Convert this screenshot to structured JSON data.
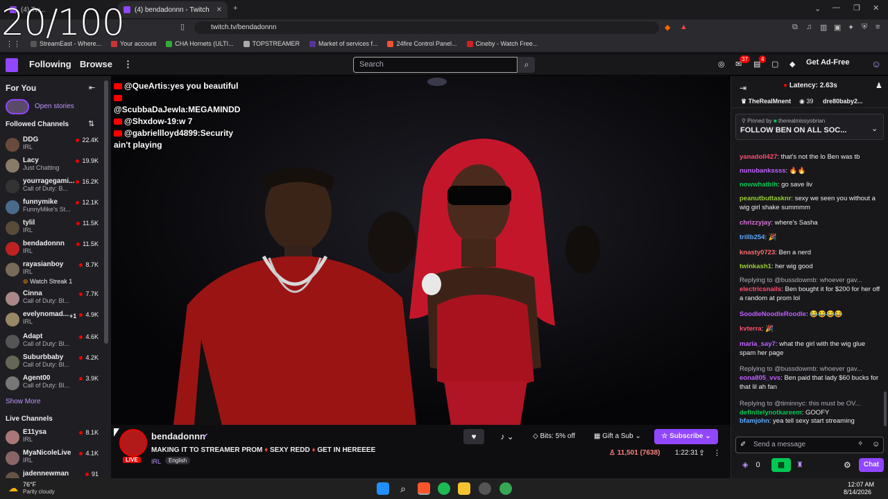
{
  "overlay": {
    "counter": "20/100"
  },
  "browser": {
    "tabs": [
      {
        "label": "(4) Tw..."
      },
      {
        "label": "(4) bendadonnn - Twitch"
      }
    ],
    "url": "twitch.tv/bendadonnn",
    "bookmarks": [
      {
        "label": "StreamEast - Where...",
        "color": "#555"
      },
      {
        "label": "Your account",
        "color": "#c33"
      },
      {
        "label": "CHA Hornets (ULTI...",
        "color": "#3a3"
      },
      {
        "label": "TOPSTREAMER",
        "color": "#aaa"
      },
      {
        "label": "Market of services f...",
        "color": "#539"
      },
      {
        "label": "24fire Control Panel...",
        "color": "#e53"
      },
      {
        "label": "Cineby - Watch Free...",
        "color": "#c22"
      }
    ]
  },
  "twitch": {
    "nav": {
      "following": "Following",
      "browse": "Browse",
      "search_placeholder": "Search",
      "badge1": "37",
      "badge2": "4",
      "ad_free": "Get Ad-Free"
    },
    "sidebar": {
      "for_you": "For You",
      "open_stories": "Open stories",
      "followed": "Followed Channels",
      "channels": [
        {
          "name": "DDG",
          "game": "IRL",
          "viewers": "22.4K",
          "color": "#6a4a3a"
        },
        {
          "name": "Lacy",
          "game": "Just Chatting",
          "viewers": "19.9K",
          "color": "#8a7a6a"
        },
        {
          "name": "yourragegami...",
          "game": "Call of Duty: B...",
          "viewers": "16.2K",
          "color": "#333"
        },
        {
          "name": "funnymike",
          "game": "FunnyMike's St...",
          "viewers": "12.1K",
          "color": "#4a6a8a"
        },
        {
          "name": "tylil",
          "game": "IRL",
          "viewers": "11.5K",
          "color": "#5a4a3a"
        },
        {
          "name": "bendadonnn",
          "game": "IRL",
          "viewers": "11.5K",
          "color": "#b22"
        },
        {
          "name": "rayasianboy",
          "game": "IRL",
          "viewers": "8.7K",
          "color": "#7a6a5a"
        },
        {
          "name": "Cinna",
          "game": "Call of Duty: Bl...",
          "viewers": "7.7K",
          "color": "#a88"
        },
        {
          "name": "evelynomad...",
          "game": "IRL",
          "viewers": "4.9K",
          "color": "#986"
        },
        {
          "name": "Adapt",
          "game": "Call of Duty: Bl...",
          "viewers": "4.6K",
          "color": "#555"
        },
        {
          "name": "Suburbbaby",
          "game": "Call of Duty: Bl...",
          "viewers": "4.2K",
          "color": "#665"
        },
        {
          "name": "Agent00",
          "game": "Call of Duty: Bl...",
          "viewers": "3.9K",
          "color": "#777"
        }
      ],
      "watch_streak": "Watch Streak 1",
      "plus_one": "+1",
      "show_more": "Show More",
      "live_channels": "Live Channels",
      "live": [
        {
          "name": "E11ysa",
          "game": "IRL",
          "viewers": "8.1K",
          "color": "#a77"
        },
        {
          "name": "MyaNicoleLive",
          "game": "IRL",
          "viewers": "4.1K",
          "color": "#866"
        },
        {
          "name": "jadennewman",
          "game": "",
          "viewers": "91",
          "color": "#654"
        }
      ]
    },
    "video_chat": [
      {
        "user": "@QueArtis",
        "text": "yes you beautiful"
      },
      {
        "user": "@ScubbaDaJewla",
        "text": "MEGAMINDD"
      },
      {
        "user": "@Shxdow-19",
        "text": "w 7"
      },
      {
        "user": "@gabriellloyd4899",
        "text": "Security ain't playing"
      }
    ],
    "stream": {
      "channel": "bendadonnn",
      "live": "LIVE",
      "title_parts": [
        "MAKING IT TO STREAMER PROM",
        "SEXY REDD",
        "GET IN HEREEEE"
      ],
      "tag1": "IRL",
      "tag2": "English",
      "bits": "Bits: 5% off",
      "gift": "Gift a Sub",
      "subscribe": "Subscribe",
      "viewers": "11,501 (7638)",
      "uptime": "1:22:31"
    },
    "chat": {
      "latency": "Latency: 2.63s",
      "top_user": "TheRealMnent",
      "top_count": "39",
      "top_user2": "dre80baby2...",
      "pinned_by": "Pinned by",
      "pinned_user": "therealmissyobrian",
      "pinned_text": "FOLLOW BEN ON ALL SOC...",
      "messages": [
        {
          "user": "yanadoll427",
          "color": "#ff4d6d",
          "text": "that's not the lo Ben was tb",
          "reply": ""
        },
        {
          "user": "nunubankssss",
          "color": "#bf5fff",
          "text": "🔥🔥",
          "reply": ""
        },
        {
          "user": "nowwhatbih",
          "color": "#00c853",
          "text": "go save liv",
          "reply": ""
        },
        {
          "user": "peanutbuttasknr",
          "color": "#9acd32",
          "text": "sexy we seen you without a wig girl shake summmm",
          "reply": ""
        },
        {
          "user": "chrizzyjay",
          "color": "#da70d6",
          "text": "where's Sasha",
          "reply": ""
        },
        {
          "user": "trillb254",
          "color": "#5ca9ff",
          "text": "🎉",
          "reply": ""
        },
        {
          "user": "knasty0723",
          "color": "#ff6b6b",
          "text": "Ben a nerd",
          "reply": ""
        },
        {
          "user": "twinkash1",
          "color": "#9acd32",
          "text": "her wig good",
          "reply": ""
        },
        {
          "user": "electricsnails",
          "color": "#ff4d6d",
          "text": "Ben bought it for $200 for her off a random at prom lol",
          "reply": "Replying to @bussdowmb: whoever gav..."
        },
        {
          "user": "SoodleNoodleRoodle",
          "color": "#bf5fff",
          "text": "😂😂😂😂",
          "reply": ""
        },
        {
          "user": "kvterra",
          "color": "#ff4d6d",
          "text": "🎉",
          "reply": ""
        },
        {
          "user": "maria_say7",
          "color": "#bf5fff",
          "text": "what the girl with the wig glue spam her page",
          "reply": ""
        },
        {
          "user": "eona805_vvs",
          "color": "#bf5fff",
          "text": "Ben paid that lady $60 bucks for that lil ah fan",
          "reply": "Replying to @bussdowmb: whoever gav..."
        },
        {
          "user": "definitelynotkareem",
          "color": "#00c853",
          "text": "GOOFY",
          "reply": "Replying to @timinnyc: this must be OV..."
        },
        {
          "user": "bfamjohn",
          "color": "#5ca9ff",
          "text": "yea tell sexy start streaming",
          "reply": ""
        }
      ],
      "input_placeholder": "Send a message",
      "points": "0",
      "chat_button": "Chat"
    }
  },
  "taskbar": {
    "temp": "76°F",
    "weather": "Partly cloudy",
    "time": "12:07 AM",
    "date": "8/14/2026"
  }
}
